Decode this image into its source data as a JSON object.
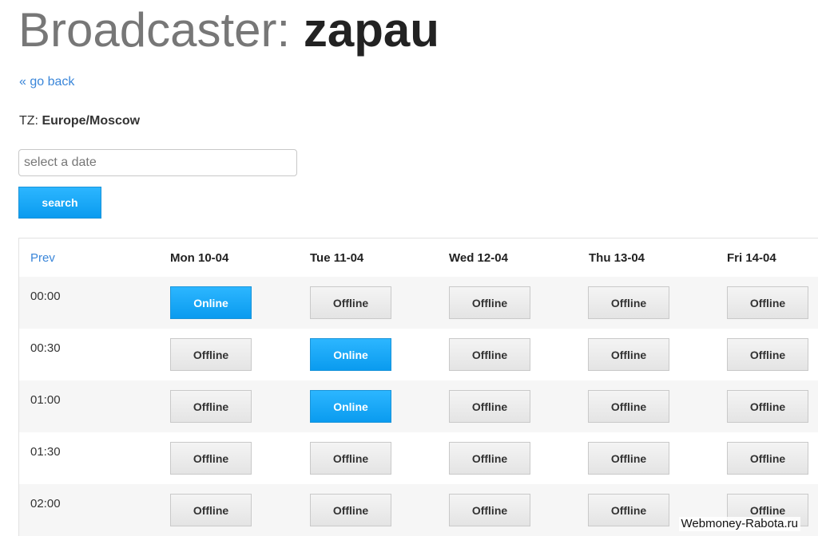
{
  "page": {
    "title_prefix": "Broadcaster: ",
    "title_name": "zapau",
    "back_link": "« go back",
    "tz_label": "TZ: ",
    "tz_value": "Europe/Moscow"
  },
  "search": {
    "placeholder": "select a date",
    "value": "",
    "button_label": "search"
  },
  "schedule": {
    "prev_label": "Prev",
    "days": [
      "Mon 10-04",
      "Tue 11-04",
      "Wed 12-04",
      "Thu 13-04",
      "Fri 14-04"
    ],
    "rows": [
      {
        "time": "00:00",
        "slots": [
          "Online",
          "Offline",
          "Offline",
          "Offline",
          "Offline"
        ]
      },
      {
        "time": "00:30",
        "slots": [
          "Offline",
          "Online",
          "Offline",
          "Offline",
          "Offline"
        ]
      },
      {
        "time": "01:00",
        "slots": [
          "Offline",
          "Online",
          "Offline",
          "Offline",
          "Offline"
        ]
      },
      {
        "time": "01:30",
        "slots": [
          "Offline",
          "Offline",
          "Offline",
          "Offline",
          "Offline"
        ]
      },
      {
        "time": "02:00",
        "slots": [
          "Offline",
          "Offline",
          "Offline",
          "Offline",
          "Offline"
        ]
      }
    ]
  },
  "watermark": "Webmoney-Rabota.ru",
  "colors": {
    "accent": "#0a9bef",
    "link": "#3a86d9",
    "title_gray": "#777777"
  }
}
